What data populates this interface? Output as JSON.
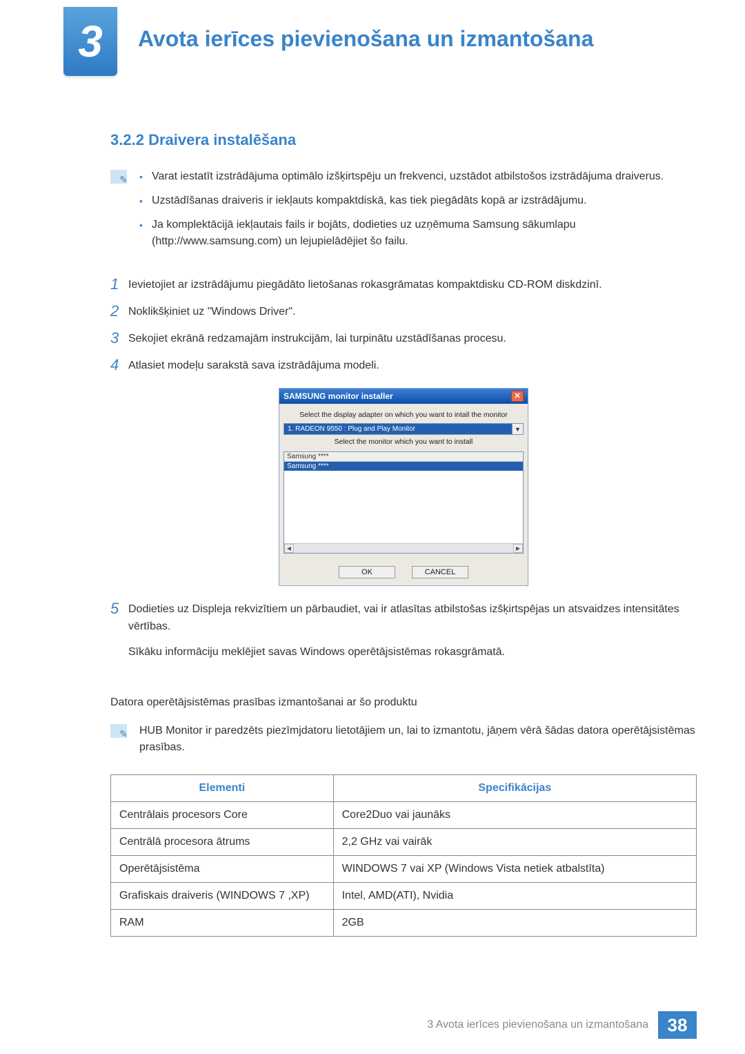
{
  "chapter": {
    "number": "3",
    "title": "Avota ierīces pievienošana un izmantošana"
  },
  "section": {
    "number": "3.2.2",
    "title": "Draivera instalēšana"
  },
  "notes": [
    "Varat iestatīt izstrādājuma optimālo izšķirtspēju un frekvenci, uzstādot atbilstošos izstrādājuma draiverus.",
    "Uzstādīšanas draiveris ir iekļauts kompaktdiskā, kas tiek piegādāts kopā ar izstrādājumu.",
    "Ja komplektācijā iekļautais fails ir bojāts, dodieties uz uzņēmuma Samsung sākumlapu (http://www.samsung.com) un lejupielādējiet šo failu."
  ],
  "steps": [
    "Ievietojiet ar izstrādājumu piegādāto lietošanas rokasgrāmatas kompaktdisku CD-ROM diskdzinī.",
    "Noklikšķiniet uz \"Windows Driver\".",
    "Sekojiet ekrānā redzamajām instrukcijām, lai turpinātu uzstādīšanas procesu.",
    "Atlasiet modeļu sarakstā sava izstrādājuma modeli."
  ],
  "step5": "Dodieties uz Displeja rekvizītiem un pārbaudiet, vai ir atlasītas atbilstošas izšķirtspējas un atsvaidzes intensitātes vērtības.",
  "step5_extra": "Sīkāku informāciju meklējiet savas Windows operētājsistēmas rokasgrāmatā.",
  "os_req_heading": "Datora operētājsistēmas prasības izmantošanai ar šo produktu",
  "os_req_note": "HUB Monitor ir paredzēts piezīmjdatoru lietotājiem un, lai to izmantotu, jāņem vērā šādas datora operētājsistēmas prasības.",
  "installer": {
    "title": "SAMSUNG monitor installer",
    "label1": "Select the display adapter on which you want to intall the monitor",
    "adapter": "1. RADEON 9550 : Plug and Play Monitor",
    "label2": "Select the monitor which you want to install",
    "item_shown": "Samsung ****",
    "item_selected": "Samsung ****",
    "ok": "OK",
    "cancel": "CANCEL"
  },
  "table": {
    "h1": "Elementi",
    "h2": "Specifikācijas",
    "rows": [
      [
        "Centrālais procesors Core",
        "Core2Duo vai jaunāks"
      ],
      [
        "Centrālā procesora ātrums",
        "2,2 GHz vai vairāk"
      ],
      [
        "Operētājsistēma",
        "WINDOWS 7 vai XP (Windows Vista netiek atbalstīta)"
      ],
      [
        "Grafiskais draiveris (WINDOWS 7 ,XP)",
        "Intel, AMD(ATI), Nvidia"
      ],
      [
        "RAM",
        "2GB"
      ]
    ]
  },
  "footer": {
    "text": "3 Avota ierīces pievienošana un izmantošana",
    "page": "38"
  }
}
